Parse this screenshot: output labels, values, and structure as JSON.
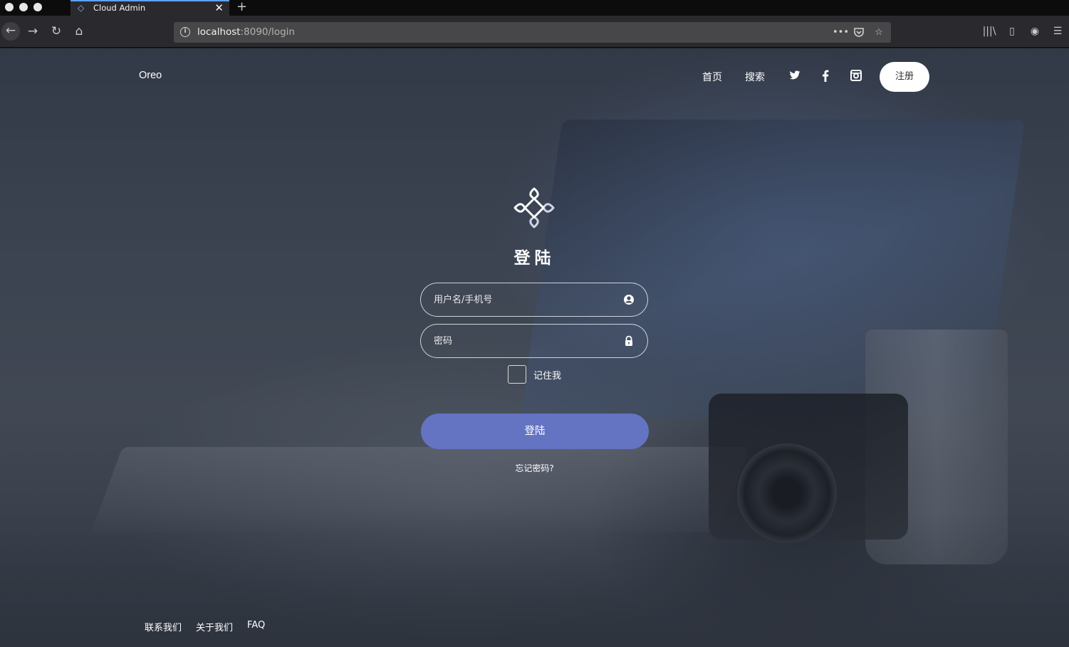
{
  "browser": {
    "tab_title": "Cloud Admin",
    "tab_close": "✕",
    "new_tab": "+",
    "url_host": "localhost",
    "url_rest": ":8090/login",
    "url_more": "•••"
  },
  "site": {
    "brand": "Oreo",
    "nav": {
      "home": "首页",
      "search": "搜索",
      "register": "注册"
    },
    "social_icons": [
      "twitter-icon",
      "facebook-icon",
      "instagram-icon"
    ]
  },
  "login": {
    "title": "登陆",
    "username_placeholder": "用户名/手机号",
    "password_placeholder": "密码",
    "remember_label": "记住我",
    "submit_label": "登陆",
    "forgot_label": "忘记密码?"
  },
  "footer": {
    "links": [
      "联系我们",
      "关于我们",
      "FAQ"
    ]
  },
  "colors": {
    "primary_button": "#6573c3",
    "browser_chrome": "#2a2a2e",
    "tab_accent": "#5ea0ff"
  }
}
